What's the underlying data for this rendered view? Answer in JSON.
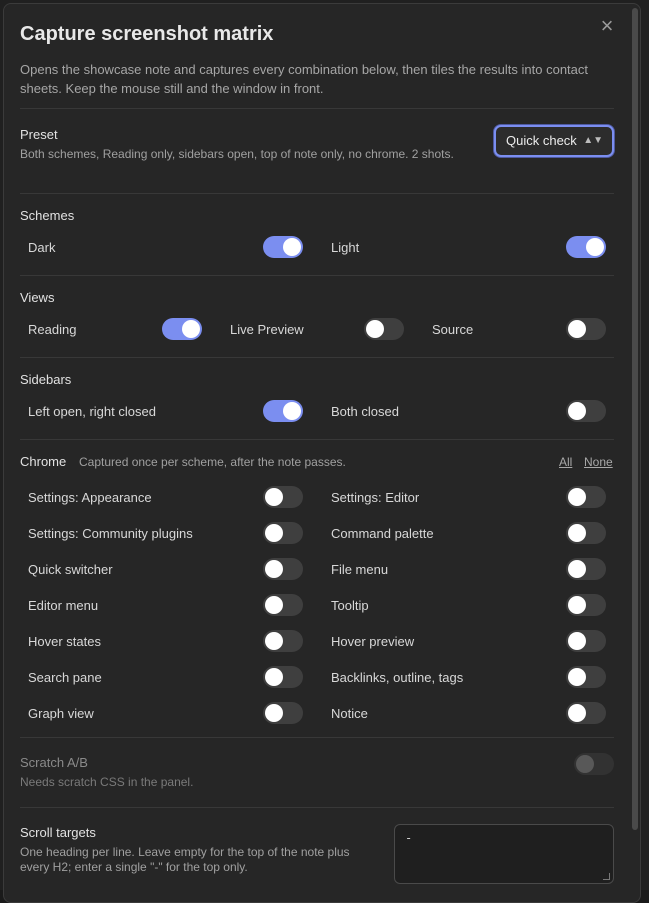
{
  "modal": {
    "title": "Capture screenshot matrix",
    "description": "Opens the showcase note and captures every combination below, then tiles the results into contact sheets. Keep the mouse still and the window in front.",
    "close_glyph": "×"
  },
  "preset": {
    "title": "Preset",
    "description": "Both schemes, Reading only, sidebars open, top of note only, no chrome. 2 shots.",
    "selected": "Quick check",
    "chevron": "⌃⌄"
  },
  "schemes": {
    "title": "Schemes",
    "items": [
      {
        "label": "Dark",
        "on": true
      },
      {
        "label": "Light",
        "on": true
      }
    ]
  },
  "views": {
    "title": "Views",
    "items": [
      {
        "label": "Reading",
        "on": true
      },
      {
        "label": "Live Preview",
        "on": false
      },
      {
        "label": "Source",
        "on": false
      }
    ]
  },
  "sidebars": {
    "title": "Sidebars",
    "items": [
      {
        "label": "Left open, right closed",
        "on": true
      },
      {
        "label": "Both closed",
        "on": false
      }
    ]
  },
  "chrome": {
    "title": "Chrome",
    "note": "Captured once per scheme, after the note passes.",
    "all_label": "All",
    "none_label": "None",
    "items": [
      {
        "label": "Settings: Appearance",
        "on": false
      },
      {
        "label": "Settings: Editor",
        "on": false
      },
      {
        "label": "Settings: Community plugins",
        "on": false
      },
      {
        "label": "Command palette",
        "on": false
      },
      {
        "label": "Quick switcher",
        "on": false
      },
      {
        "label": "File menu",
        "on": false
      },
      {
        "label": "Editor menu",
        "on": false
      },
      {
        "label": "Tooltip",
        "on": false
      },
      {
        "label": "Hover states",
        "on": false
      },
      {
        "label": "Hover preview",
        "on": false
      },
      {
        "label": "Search pane",
        "on": false
      },
      {
        "label": "Backlinks, outline, tags",
        "on": false
      },
      {
        "label": "Graph view",
        "on": false
      },
      {
        "label": "Notice",
        "on": false
      }
    ]
  },
  "scratch": {
    "title": "Scratch A/B",
    "description": "Needs scratch CSS in the panel.",
    "on": false
  },
  "scroll_targets": {
    "title": "Scroll targets",
    "description": "One heading per line. Leave empty for the top of the note plus every H2; enter a single \"-\" for the top only.",
    "value": "-"
  },
  "colors": {
    "accent": "#7b8ef0",
    "background": "#262626"
  }
}
